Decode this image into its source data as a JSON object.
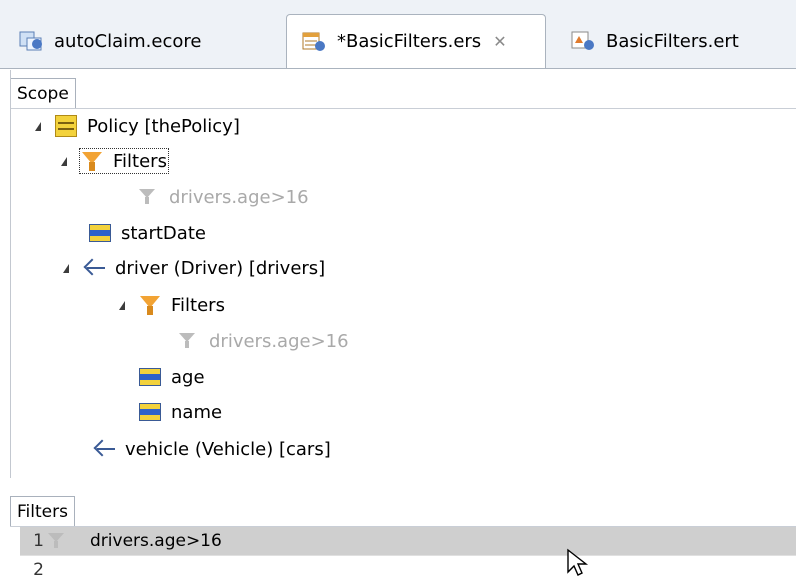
{
  "tabs": [
    {
      "label": "autoClaim.ecore",
      "icon": "ecore-model-icon",
      "active": false
    },
    {
      "label": "*BasicFilters.ers",
      "icon": "ers-file-icon",
      "active": true,
      "close": "✕"
    },
    {
      "label": "BasicFilters.ert",
      "icon": "ert-file-icon",
      "active": false
    }
  ],
  "scope": {
    "tab_label": "Scope",
    "tree": [
      {
        "label": "Policy [thePolicy]",
        "icon": "class-icon"
      },
      {
        "label": "Filters",
        "icon": "filter-folder-icon"
      },
      {
        "label": "drivers.age>16",
        "icon": "funnel-icon"
      },
      {
        "label": "startDate",
        "icon": "attribute-icon"
      },
      {
        "label": "driver (Driver) [drivers]",
        "icon": "reference-icon"
      },
      {
        "label": "Filters",
        "icon": "filter-folder-icon"
      },
      {
        "label": "drivers.age>16",
        "icon": "funnel-icon"
      },
      {
        "label": "age",
        "icon": "attribute-icon"
      },
      {
        "label": "name",
        "icon": "attribute-icon"
      },
      {
        "label": "vehicle (Vehicle) [cars]",
        "icon": "reference-icon"
      }
    ]
  },
  "filters": {
    "tab_label": "Filters",
    "rows": [
      {
        "num": "1",
        "expression": "drivers.age>16"
      },
      {
        "num": "2",
        "expression": ""
      }
    ]
  },
  "colors": {
    "tabbar_bg": "#eef2f7",
    "selected_row": "#cfcfcf",
    "muted_text": "#a9a9a9"
  }
}
